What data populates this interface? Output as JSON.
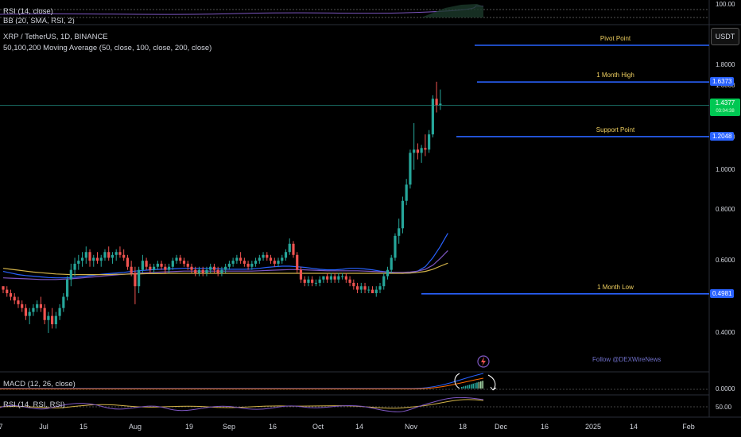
{
  "top_panel": {
    "rsi_label": "RSI (14, close)",
    "bb_label": "BB (20, SMA, RSI, 2)",
    "level": "100.00"
  },
  "main": {
    "title": "XRP / TetherUS, 1D, BINANCE",
    "ma_label": "50,100,200 Moving Average (50, close, 100, close, 200, close)",
    "currency_button": "USDT",
    "current_price": "1.4377",
    "current_price_sub": "03:04:38",
    "follow_text": "Follow @DEXWireNews"
  },
  "levels": [
    {
      "name": "Pivot Point",
      "value": 1.92,
      "price_label": ""
    },
    {
      "name": "1 Month High",
      "value": 1.6373,
      "price_label": "1.6373"
    },
    {
      "name": "Support Point",
      "value": 1.2048,
      "price_label": "1.2048"
    },
    {
      "name": "1 Month Low",
      "value": 0.4981,
      "price_label": "0.4981"
    }
  ],
  "price_axis": {
    "ticks": [
      "1.8000",
      "1.6000",
      "1.4000",
      "1.2000",
      "1.0000",
      "0.8000",
      "0.6000",
      "0.4000"
    ],
    "tick_values": [
      1.8,
      1.6,
      1.4,
      1.2,
      1.0,
      0.8,
      0.6,
      0.4
    ]
  },
  "macd_panel": {
    "label": "MACD (12, 26, close)",
    "level": "0.0000"
  },
  "rsi_panel": {
    "label": "RSI (14, RSI, RSI)",
    "level": "50.00"
  },
  "date_axis": [
    "7",
    "Jul",
    "15",
    "Aug",
    "19",
    "Sep",
    "16",
    "Oct",
    "14",
    "Nov",
    "18",
    "Dec",
    "16",
    "2025",
    "14",
    "Feb"
  ],
  "colors": {
    "up": "#26a69a",
    "down": "#ef5350",
    "level_line": "#2962ff",
    "level_text": "#f0d060",
    "ma50": "#2962ff",
    "ma100": "#7e57c2",
    "ma200": "#d4b44a",
    "price_line": "#26a69a",
    "current_tag": "#00c853"
  },
  "chart_data": {
    "type": "candlestick",
    "title": "XRP / TetherUS, 1D, BINANCE",
    "ylim": [
      0.3,
      2.1
    ],
    "candles": [
      [
        0.52,
        0.52,
        0.5,
        0.51
      ],
      [
        0.51,
        0.52,
        0.49,
        0.5
      ],
      [
        0.5,
        0.51,
        0.48,
        0.49
      ],
      [
        0.49,
        0.5,
        0.47,
        0.48
      ],
      [
        0.48,
        0.49,
        0.46,
        0.47
      ],
      [
        0.47,
        0.48,
        0.45,
        0.46
      ],
      [
        0.46,
        0.47,
        0.43,
        0.44
      ],
      [
        0.44,
        0.46,
        0.42,
        0.45
      ],
      [
        0.45,
        0.47,
        0.44,
        0.46
      ],
      [
        0.46,
        0.48,
        0.45,
        0.47
      ],
      [
        0.47,
        0.49,
        0.45,
        0.46
      ],
      [
        0.46,
        0.47,
        0.42,
        0.43
      ],
      [
        0.43,
        0.45,
        0.4,
        0.44
      ],
      [
        0.44,
        0.46,
        0.41,
        0.42
      ],
      [
        0.42,
        0.45,
        0.41,
        0.44
      ],
      [
        0.44,
        0.47,
        0.43,
        0.46
      ],
      [
        0.46,
        0.5,
        0.45,
        0.49
      ],
      [
        0.49,
        0.55,
        0.48,
        0.54
      ],
      [
        0.54,
        0.59,
        0.52,
        0.57
      ],
      [
        0.57,
        0.61,
        0.55,
        0.59
      ],
      [
        0.59,
        0.62,
        0.57,
        0.6
      ],
      [
        0.6,
        0.63,
        0.58,
        0.61
      ],
      [
        0.61,
        0.65,
        0.59,
        0.63
      ],
      [
        0.63,
        0.64,
        0.58,
        0.6
      ],
      [
        0.6,
        0.62,
        0.58,
        0.61
      ],
      [
        0.61,
        0.63,
        0.59,
        0.6
      ],
      [
        0.6,
        0.62,
        0.58,
        0.61
      ],
      [
        0.61,
        0.64,
        0.6,
        0.63
      ],
      [
        0.63,
        0.65,
        0.6,
        0.61
      ],
      [
        0.61,
        0.63,
        0.59,
        0.62
      ],
      [
        0.62,
        0.64,
        0.6,
        0.63
      ],
      [
        0.63,
        0.65,
        0.61,
        0.62
      ],
      [
        0.62,
        0.64,
        0.6,
        0.61
      ],
      [
        0.61,
        0.62,
        0.57,
        0.58
      ],
      [
        0.58,
        0.6,
        0.55,
        0.56
      ],
      [
        0.56,
        0.58,
        0.47,
        0.52
      ],
      [
        0.52,
        0.58,
        0.5,
        0.57
      ],
      [
        0.57,
        0.62,
        0.56,
        0.6
      ],
      [
        0.6,
        0.61,
        0.57,
        0.58
      ],
      [
        0.58,
        0.59,
        0.56,
        0.57
      ],
      [
        0.57,
        0.59,
        0.56,
        0.58
      ],
      [
        0.58,
        0.6,
        0.57,
        0.59
      ],
      [
        0.59,
        0.6,
        0.57,
        0.58
      ],
      [
        0.58,
        0.59,
        0.56,
        0.57
      ],
      [
        0.57,
        0.59,
        0.56,
        0.58
      ],
      [
        0.58,
        0.61,
        0.57,
        0.6
      ],
      [
        0.6,
        0.62,
        0.59,
        0.61
      ],
      [
        0.61,
        0.62,
        0.59,
        0.6
      ],
      [
        0.6,
        0.61,
        0.58,
        0.59
      ],
      [
        0.59,
        0.6,
        0.57,
        0.58
      ],
      [
        0.58,
        0.59,
        0.56,
        0.57
      ],
      [
        0.57,
        0.58,
        0.55,
        0.56
      ],
      [
        0.56,
        0.58,
        0.55,
        0.57
      ],
      [
        0.57,
        0.58,
        0.55,
        0.56
      ],
      [
        0.56,
        0.58,
        0.55,
        0.57
      ],
      [
        0.57,
        0.59,
        0.56,
        0.58
      ],
      [
        0.58,
        0.59,
        0.56,
        0.57
      ],
      [
        0.57,
        0.58,
        0.55,
        0.56
      ],
      [
        0.56,
        0.58,
        0.55,
        0.57
      ],
      [
        0.57,
        0.59,
        0.56,
        0.58
      ],
      [
        0.58,
        0.6,
        0.57,
        0.59
      ],
      [
        0.59,
        0.61,
        0.58,
        0.6
      ],
      [
        0.6,
        0.62,
        0.59,
        0.61
      ],
      [
        0.61,
        0.63,
        0.59,
        0.6
      ],
      [
        0.6,
        0.61,
        0.58,
        0.59
      ],
      [
        0.59,
        0.6,
        0.57,
        0.58
      ],
      [
        0.58,
        0.6,
        0.57,
        0.59
      ],
      [
        0.59,
        0.61,
        0.58,
        0.6
      ],
      [
        0.6,
        0.62,
        0.59,
        0.61
      ],
      [
        0.61,
        0.63,
        0.6,
        0.62
      ],
      [
        0.62,
        0.63,
        0.6,
        0.61
      ],
      [
        0.61,
        0.62,
        0.59,
        0.6
      ],
      [
        0.6,
        0.61,
        0.58,
        0.59
      ],
      [
        0.59,
        0.61,
        0.58,
        0.6
      ],
      [
        0.6,
        0.62,
        0.59,
        0.61
      ],
      [
        0.61,
        0.64,
        0.6,
        0.63
      ],
      [
        0.63,
        0.68,
        0.62,
        0.66
      ],
      [
        0.66,
        0.67,
        0.61,
        0.62
      ],
      [
        0.62,
        0.63,
        0.56,
        0.57
      ],
      [
        0.57,
        0.58,
        0.53,
        0.54
      ],
      [
        0.54,
        0.55,
        0.52,
        0.53
      ],
      [
        0.53,
        0.55,
        0.52,
        0.54
      ],
      [
        0.54,
        0.55,
        0.52,
        0.53
      ],
      [
        0.53,
        0.54,
        0.52,
        0.53
      ],
      [
        0.53,
        0.55,
        0.52,
        0.54
      ],
      [
        0.54,
        0.55,
        0.53,
        0.55
      ],
      [
        0.55,
        0.56,
        0.53,
        0.54
      ],
      [
        0.54,
        0.56,
        0.53,
        0.55
      ],
      [
        0.55,
        0.56,
        0.53,
        0.54
      ],
      [
        0.54,
        0.56,
        0.53,
        0.55
      ],
      [
        0.55,
        0.56,
        0.54,
        0.55
      ],
      [
        0.55,
        0.56,
        0.53,
        0.54
      ],
      [
        0.54,
        0.55,
        0.52,
        0.53
      ],
      [
        0.53,
        0.54,
        0.51,
        0.52
      ],
      [
        0.52,
        0.53,
        0.5,
        0.51
      ],
      [
        0.51,
        0.53,
        0.5,
        0.52
      ],
      [
        0.52,
        0.53,
        0.5,
        0.51
      ],
      [
        0.51,
        0.52,
        0.5,
        0.51
      ],
      [
        0.51,
        0.52,
        0.5,
        0.5
      ],
      [
        0.5,
        0.52,
        0.49,
        0.51
      ],
      [
        0.51,
        0.53,
        0.5,
        0.52
      ],
      [
        0.52,
        0.56,
        0.51,
        0.55
      ],
      [
        0.55,
        0.58,
        0.54,
        0.57
      ],
      [
        0.57,
        0.62,
        0.56,
        0.61
      ],
      [
        0.61,
        0.7,
        0.6,
        0.69
      ],
      [
        0.69,
        0.76,
        0.66,
        0.72
      ],
      [
        0.72,
        0.86,
        0.7,
        0.84
      ],
      [
        0.84,
        0.95,
        0.82,
        0.92
      ],
      [
        0.92,
        1.12,
        0.9,
        1.1
      ],
      [
        1.1,
        1.3,
        1.0,
        1.12
      ],
      [
        1.12,
        1.16,
        1.06,
        1.1
      ],
      [
        1.1,
        1.15,
        1.04,
        1.13
      ],
      [
        1.13,
        1.22,
        1.08,
        1.12
      ],
      [
        1.12,
        1.25,
        1.1,
        1.22
      ],
      [
        1.22,
        1.52,
        1.2,
        1.49
      ],
      [
        1.49,
        1.64,
        1.38,
        1.44
      ],
      [
        1.44,
        1.57,
        1.4,
        1.45
      ]
    ],
    "series": [
      {
        "name": "MA 50",
        "values": [
          0.565,
          0.56,
          0.555,
          0.552,
          0.55,
          0.548,
          0.546,
          0.545,
          0.545,
          0.546,
          0.548,
          0.55,
          0.553,
          0.556,
          0.558,
          0.56,
          0.562,
          0.565,
          0.567,
          0.569,
          0.571,
          0.572,
          0.573,
          0.574,
          0.575,
          0.575,
          0.575,
          0.575,
          0.574,
          0.573,
          0.572,
          0.572,
          0.572,
          0.573,
          0.575,
          0.578,
          0.58,
          0.582,
          0.582,
          0.58,
          0.578,
          0.575,
          0.572,
          0.57,
          0.57,
          0.572,
          0.575,
          0.575,
          0.573,
          0.57,
          0.566,
          0.563,
          0.56,
          0.559,
          0.56,
          0.566,
          0.58,
          0.61,
          0.65,
          0.7
        ]
      },
      {
        "name": "MA 100",
        "values": [
          0.545,
          0.544,
          0.543,
          0.542,
          0.541,
          0.54,
          0.54,
          0.54,
          0.541,
          0.542,
          0.544,
          0.546,
          0.548,
          0.55,
          0.552,
          0.554,
          0.556,
          0.558,
          0.56,
          0.561,
          0.562,
          0.563,
          0.564,
          0.565,
          0.566,
          0.566,
          0.566,
          0.566,
          0.566,
          0.566,
          0.566,
          0.566,
          0.566,
          0.566,
          0.567,
          0.568,
          0.569,
          0.57,
          0.571,
          0.571,
          0.57,
          0.569,
          0.568,
          0.567,
          0.567,
          0.567,
          0.567,
          0.567,
          0.566,
          0.565,
          0.564,
          0.563,
          0.562,
          0.562,
          0.563,
          0.566,
          0.572,
          0.585,
          0.608,
          0.635
        ]
      },
      {
        "name": "MA 200",
        "values": [
          0.575,
          0.572,
          0.569,
          0.566,
          0.563,
          0.561,
          0.559,
          0.557,
          0.556,
          0.555,
          0.555,
          0.555,
          0.555,
          0.555,
          0.555,
          0.556,
          0.556,
          0.557,
          0.557,
          0.558,
          0.558,
          0.558,
          0.559,
          0.559,
          0.559,
          0.559,
          0.559,
          0.559,
          0.559,
          0.559,
          0.559,
          0.559,
          0.559,
          0.559,
          0.559,
          0.559,
          0.559,
          0.559,
          0.559,
          0.559,
          0.559,
          0.559,
          0.559,
          0.559,
          0.559,
          0.559,
          0.559,
          0.559,
          0.559,
          0.559,
          0.559,
          0.559,
          0.559,
          0.559,
          0.56,
          0.562,
          0.565,
          0.572,
          0.582,
          0.592
        ]
      }
    ]
  }
}
